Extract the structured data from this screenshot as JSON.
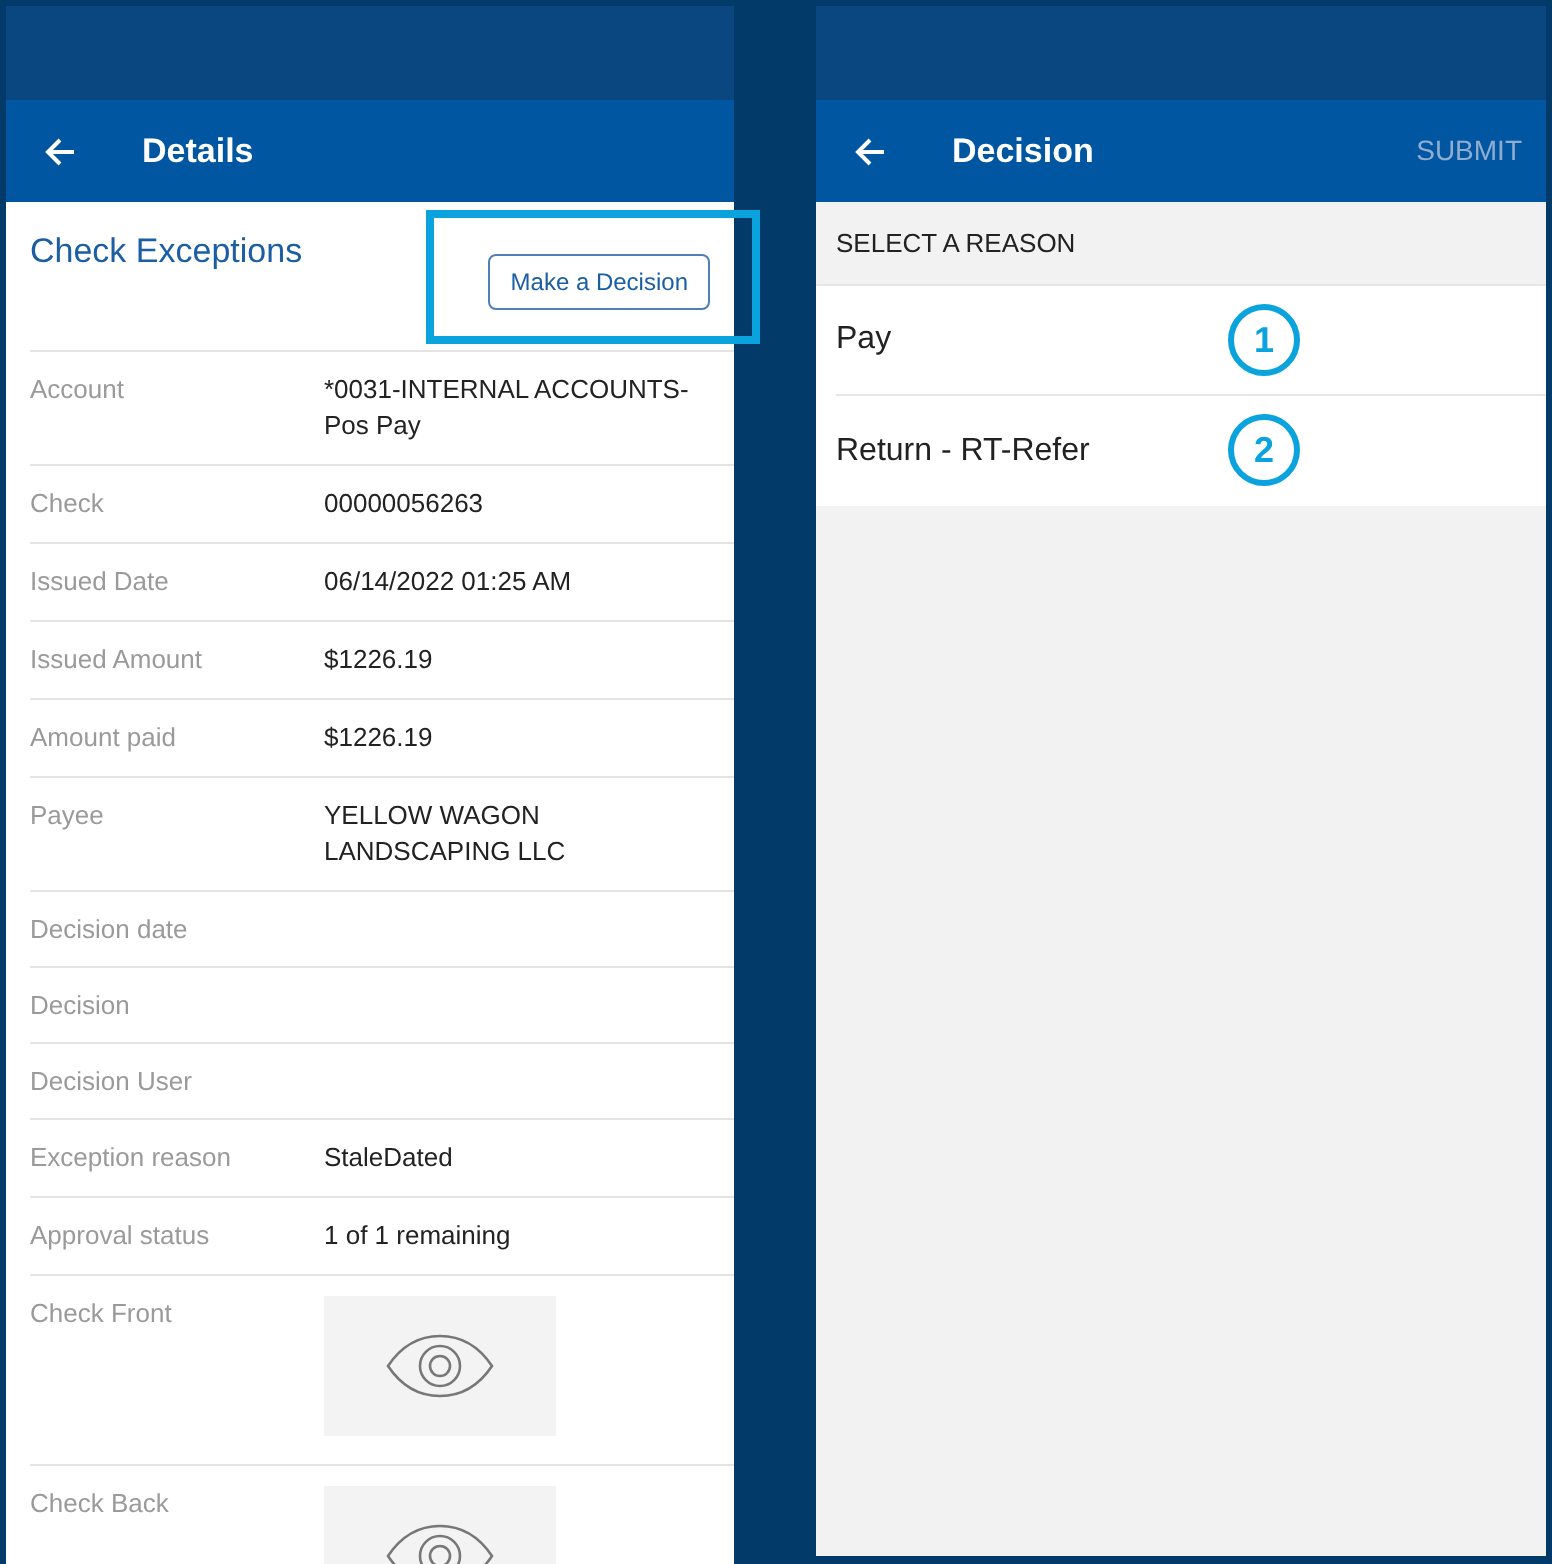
{
  "details_screen": {
    "header": {
      "title": "Details"
    },
    "section_title": "Check Exceptions",
    "decision_button": {
      "label": "Make a Decision",
      "highlighted": true
    },
    "fields": [
      {
        "kind": "text",
        "label": "Account",
        "value": "*0031-INTERNAL ACCOUNTS-Pos Pay"
      },
      {
        "kind": "text",
        "label": "Check",
        "value": "00000056263"
      },
      {
        "kind": "text",
        "label": "Issued Date",
        "value": "06/14/2022 01:25 AM"
      },
      {
        "kind": "text",
        "label": "Issued Amount",
        "value": "$1226.19"
      },
      {
        "kind": "text",
        "label": "Amount paid",
        "value": "$1226.19"
      },
      {
        "kind": "text",
        "label": "Payee",
        "value": "YELLOW WAGON LANDSCAPING LLC"
      },
      {
        "kind": "text",
        "label": "Decision date"
      },
      {
        "kind": "text",
        "label": "Decision"
      },
      {
        "kind": "text",
        "label": "Decision User"
      },
      {
        "kind": "text",
        "label": "Exception reason",
        "value": "StaleDated"
      },
      {
        "kind": "text",
        "label": "Approval status",
        "value": "1 of 1 remaining"
      },
      {
        "kind": "image",
        "label": "Check Front"
      },
      {
        "kind": "image",
        "label": "Check Back"
      }
    ]
  },
  "decision_screen": {
    "header": {
      "title": "Decision",
      "action": {
        "label": "SUBMIT",
        "disabled": true
      }
    },
    "section_label": "SELECT A REASON",
    "reasons": [
      {
        "label": "Pay",
        "marker": "1"
      },
      {
        "label": "Return - RT-Refer",
        "marker": "2"
      }
    ]
  }
}
